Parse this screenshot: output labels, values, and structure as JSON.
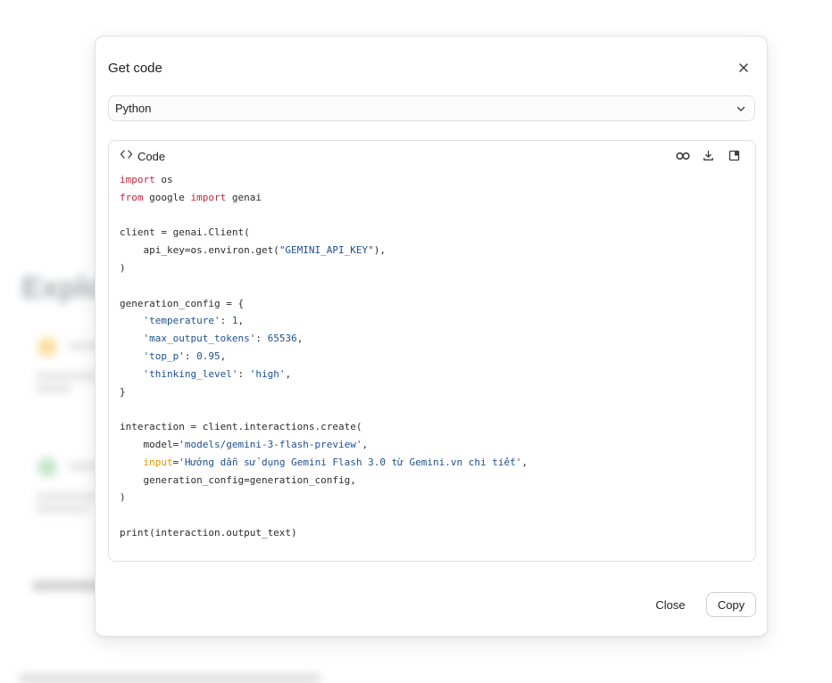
{
  "dialog": {
    "title": "Get code",
    "language": {
      "selected": "Python"
    },
    "code_panel": {
      "label": "Code"
    },
    "footer": {
      "close_label": "Close",
      "copy_label": "Copy"
    }
  },
  "toolbar_icons": [
    "colab-icon",
    "download-icon",
    "open-in-editor-icon"
  ],
  "code_lines": [
    [
      {
        "t": "import",
        "c": "kw"
      },
      {
        "t": " os"
      }
    ],
    [
      {
        "t": "from",
        "c": "kw"
      },
      {
        "t": " google "
      },
      {
        "t": "import",
        "c": "kw"
      },
      {
        "t": " genai"
      }
    ],
    [],
    [
      {
        "t": "client = genai.Client("
      }
    ],
    [
      {
        "t": "    api_key=os.environ.get("
      },
      {
        "t": "\"GEMINI_API_KEY\"",
        "c": "str"
      },
      {
        "t": "),"
      }
    ],
    [
      {
        "t": ")"
      }
    ],
    [],
    [
      {
        "t": "generation_config = {"
      }
    ],
    [
      {
        "t": "    "
      },
      {
        "t": "'temperature'",
        "c": "str"
      },
      {
        "t": ": "
      },
      {
        "t": "1",
        "c": "num"
      },
      {
        "t": ","
      }
    ],
    [
      {
        "t": "    "
      },
      {
        "t": "'max_output_tokens'",
        "c": "str"
      },
      {
        "t": ": "
      },
      {
        "t": "65536",
        "c": "num"
      },
      {
        "t": ","
      }
    ],
    [
      {
        "t": "    "
      },
      {
        "t": "'top_p'",
        "c": "str"
      },
      {
        "t": ": "
      },
      {
        "t": "0.95",
        "c": "num"
      },
      {
        "t": ","
      }
    ],
    [
      {
        "t": "    "
      },
      {
        "t": "'thinking_level'",
        "c": "str"
      },
      {
        "t": ": "
      },
      {
        "t": "'high'",
        "c": "str"
      },
      {
        "t": ","
      }
    ],
    [
      {
        "t": "}"
      }
    ],
    [],
    [
      {
        "t": "interaction = client.interactions.create("
      }
    ],
    [
      {
        "t": "    model="
      },
      {
        "t": "'models/gemini-3-flash-preview'",
        "c": "str"
      },
      {
        "t": ","
      }
    ],
    [
      {
        "t": "    "
      },
      {
        "t": "input",
        "c": "builtin"
      },
      {
        "t": "="
      },
      {
        "t": "'Hướng dẫn sử dụng Gemini Flash 3.0 từ Gemini.vn chi tiết'",
        "c": "str"
      },
      {
        "t": ","
      }
    ],
    [
      {
        "t": "    generation_config=generation_config,"
      }
    ],
    [
      {
        "t": ")"
      }
    ],
    [],
    [
      {
        "t": "print(interaction.output_text)"
      }
    ]
  ],
  "colors": {
    "keyword": "#c8243b",
    "string": "#1f4f8f",
    "builtin": "#e39400",
    "text": "#1f1f1f"
  }
}
